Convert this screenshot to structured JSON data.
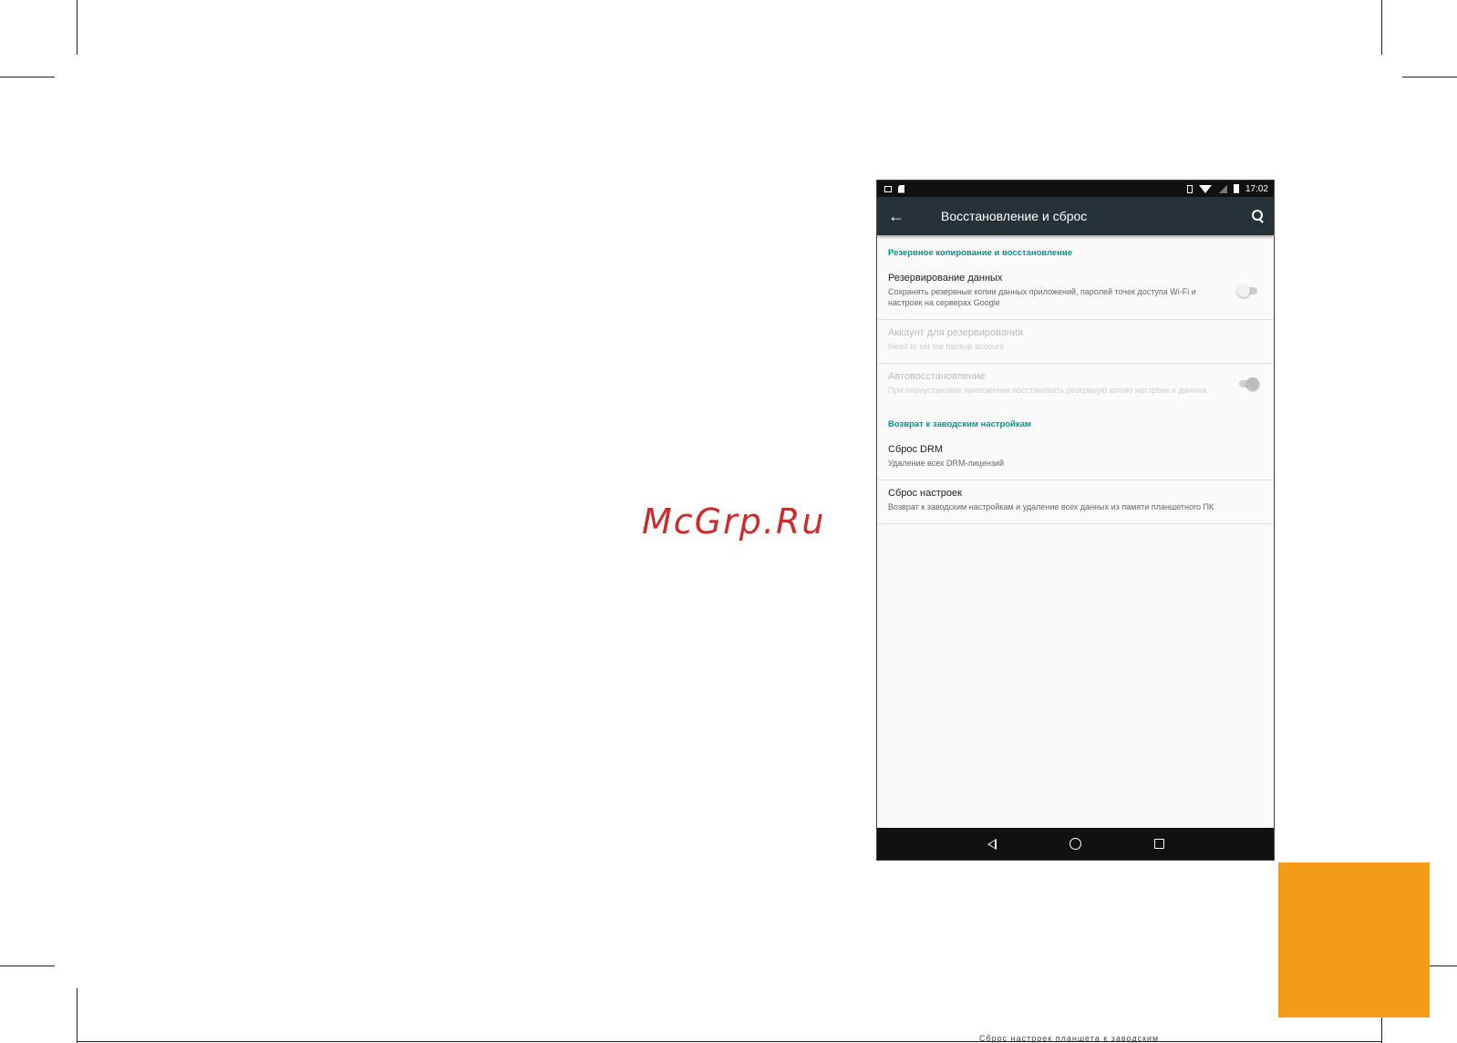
{
  "watermark": "McGrp.Ru",
  "status_bar": {
    "time": "17:02"
  },
  "app_bar": {
    "title": "Восстановление и сброс"
  },
  "sections": [
    {
      "header": "Резервное копирование и восстановление",
      "items": [
        {
          "title": "Резервирование данных",
          "summary": "Сохранять резервные копии данных приложений, паролей точек доступа Wi-Fi и настроек на серверах Google",
          "switch": "off",
          "enabled": true
        },
        {
          "title": "Аккаунт для резервирования",
          "summary": "Need to set the backup account",
          "enabled": false
        },
        {
          "title": "Автовосстановление",
          "summary": "При переустановке приложения восстановить резервную копию настроек и данных",
          "switch": "on",
          "enabled": false
        }
      ]
    },
    {
      "header": "Возврат к заводским настройкам",
      "items": [
        {
          "title": "Сброс DRM",
          "summary": "Удаление всех DRM-лицензий",
          "enabled": true
        },
        {
          "title": "Сброс настроек",
          "summary": "Возврат к заводским настройкам и удаление всех данных из памяти планшетного ПК",
          "enabled": true
        }
      ]
    }
  ],
  "colors": {
    "accent": "#009688",
    "toolbar": "#263238",
    "orange_block": "#f39c19",
    "watermark": "#cf2a2a"
  },
  "page": {
    "footer_text": "Сброс настроек планшета к заводским"
  }
}
